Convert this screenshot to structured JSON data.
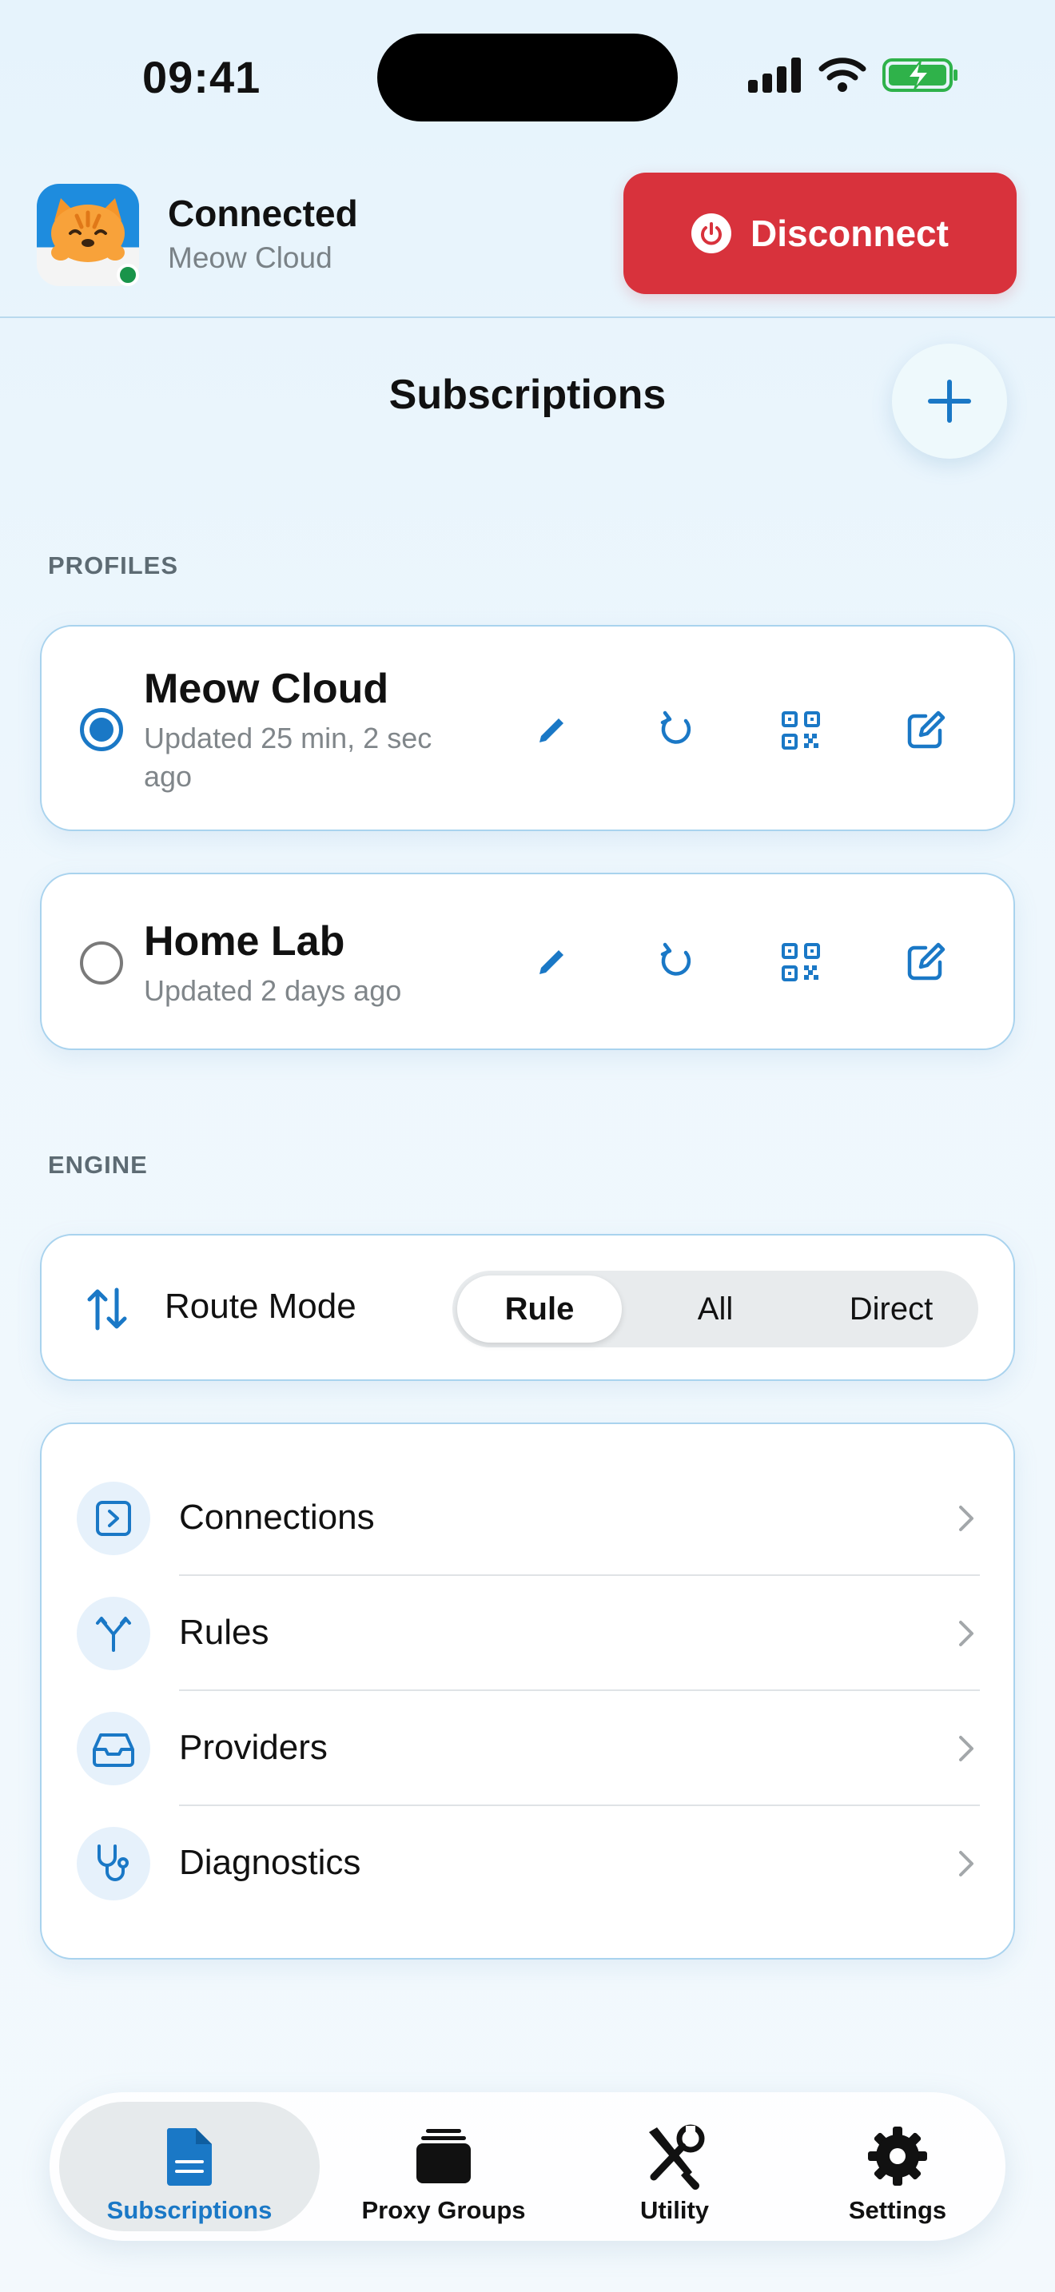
{
  "status_bar": {
    "time": "09:41"
  },
  "header": {
    "status": "Connected",
    "profile": "Meow Cloud",
    "disconnect_label": "Disconnect"
  },
  "page": {
    "title": "Subscriptions"
  },
  "profiles": {
    "section_label": "PROFILES",
    "items": [
      {
        "name": "Meow Cloud",
        "updated": "Updated 25 min, 2 sec ago",
        "selected": true
      },
      {
        "name": "Home Lab",
        "updated": "Updated 2 days ago",
        "selected": false
      }
    ]
  },
  "engine": {
    "section_label": "ENGINE",
    "route_mode_label": "Route Mode",
    "modes": [
      "Rule",
      "All",
      "Direct"
    ],
    "selected_mode": "Rule"
  },
  "nav_list": [
    {
      "label": "Connections",
      "icon": "terminal-square-icon"
    },
    {
      "label": "Rules",
      "icon": "fork-icon"
    },
    {
      "label": "Providers",
      "icon": "inbox-tray-icon"
    },
    {
      "label": "Diagnostics",
      "icon": "stethoscope-icon"
    }
  ],
  "tabbar": {
    "items": [
      {
        "label": "Subscriptions",
        "icon": "document-icon",
        "active": true
      },
      {
        "label": "Proxy Groups",
        "icon": "stack-icon",
        "active": false
      },
      {
        "label": "Utility",
        "icon": "tools-icon",
        "active": false
      },
      {
        "label": "Settings",
        "icon": "gear-icon",
        "active": false
      }
    ]
  },
  "colors": {
    "accent": "#1a78c6",
    "danger": "#d8323c",
    "online": "#19944a",
    "card_border": "#a9d3ee"
  }
}
